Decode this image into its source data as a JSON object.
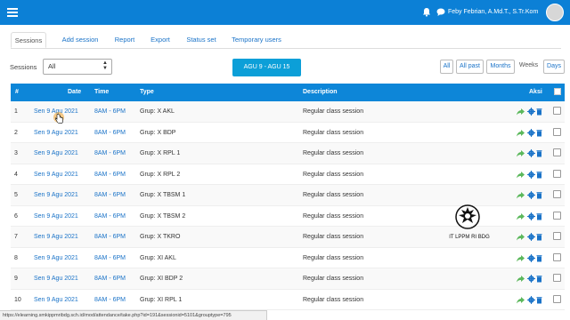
{
  "topbar": {
    "user_name": "Feby Febrian, A.Md.T., S.Tr.Kom",
    "icons": [
      "menu-icon",
      "bell-icon",
      "chat-icon",
      "avatar"
    ]
  },
  "tabs": [
    "Sessions",
    "Add session",
    "Report",
    "Export",
    "Status set",
    "Temporary users"
  ],
  "filter": {
    "label": "Sessions",
    "selected": "All",
    "range_label": "AGU 9 - AGU 15"
  },
  "views": [
    "All",
    "All past",
    "Months",
    "Weeks",
    "Days"
  ],
  "table": {
    "headers": {
      "num": "#",
      "date": "Date",
      "time": "Time",
      "type": "Type",
      "description": "Description",
      "aksi": "Aksi"
    },
    "rows": [
      {
        "num": "1",
        "date": "Sen 9 Agu 2021",
        "time": "8AM - 6PM",
        "type": "Grup: X AKL",
        "description": "Regular class session"
      },
      {
        "num": "2",
        "date": "Sen 9 Agu 2021",
        "time": "8AM - 6PM",
        "type": "Grup: X BDP",
        "description": "Regular class session"
      },
      {
        "num": "3",
        "date": "Sen 9 Agu 2021",
        "time": "8AM - 6PM",
        "type": "Grup: X RPL 1",
        "description": "Regular class session"
      },
      {
        "num": "4",
        "date": "Sen 9 Agu 2021",
        "time": "8AM - 6PM",
        "type": "Grup: X RPL 2",
        "description": "Regular class session"
      },
      {
        "num": "5",
        "date": "Sen 9 Agu 2021",
        "time": "8AM - 6PM",
        "type": "Grup: X TBSM 1",
        "description": "Regular class session"
      },
      {
        "num": "6",
        "date": "Sen 9 Agu 2021",
        "time": "8AM - 6PM",
        "type": "Grup: X TBSM 2",
        "description": "Regular class session"
      },
      {
        "num": "7",
        "date": "Sen 9 Agu 2021",
        "time": "8AM - 6PM",
        "type": "Grup: X TKRO",
        "description": "Regular class session"
      },
      {
        "num": "8",
        "date": "Sen 9 Agu 2021",
        "time": "8AM - 6PM",
        "type": "Grup: XI AKL",
        "description": "Regular class session"
      },
      {
        "num": "9",
        "date": "Sen 9 Agu 2021",
        "time": "8AM - 6PM",
        "type": "Grup: XI BDP 2",
        "description": "Regular class session"
      },
      {
        "num": "10",
        "date": "Sen 9 Agu 2021",
        "time": "8AM - 6PM",
        "type": "Grup: XI RPL 1",
        "description": "Regular class session"
      }
    ]
  },
  "watermark": {
    "text": "IT LPPM RI BDG"
  },
  "statusbar": {
    "url": "https://elearning.smkippmribdg.sch.id/mod/attendance/take.php?id=191&sessionid=5101&grouptype=795"
  },
  "colors": {
    "primary": "#0c80d6",
    "header": "#0d86d8",
    "range_button": "#0c9fd8",
    "link": "#1a73c8",
    "share": "#5cb85c",
    "gear": "#1a73c8"
  }
}
